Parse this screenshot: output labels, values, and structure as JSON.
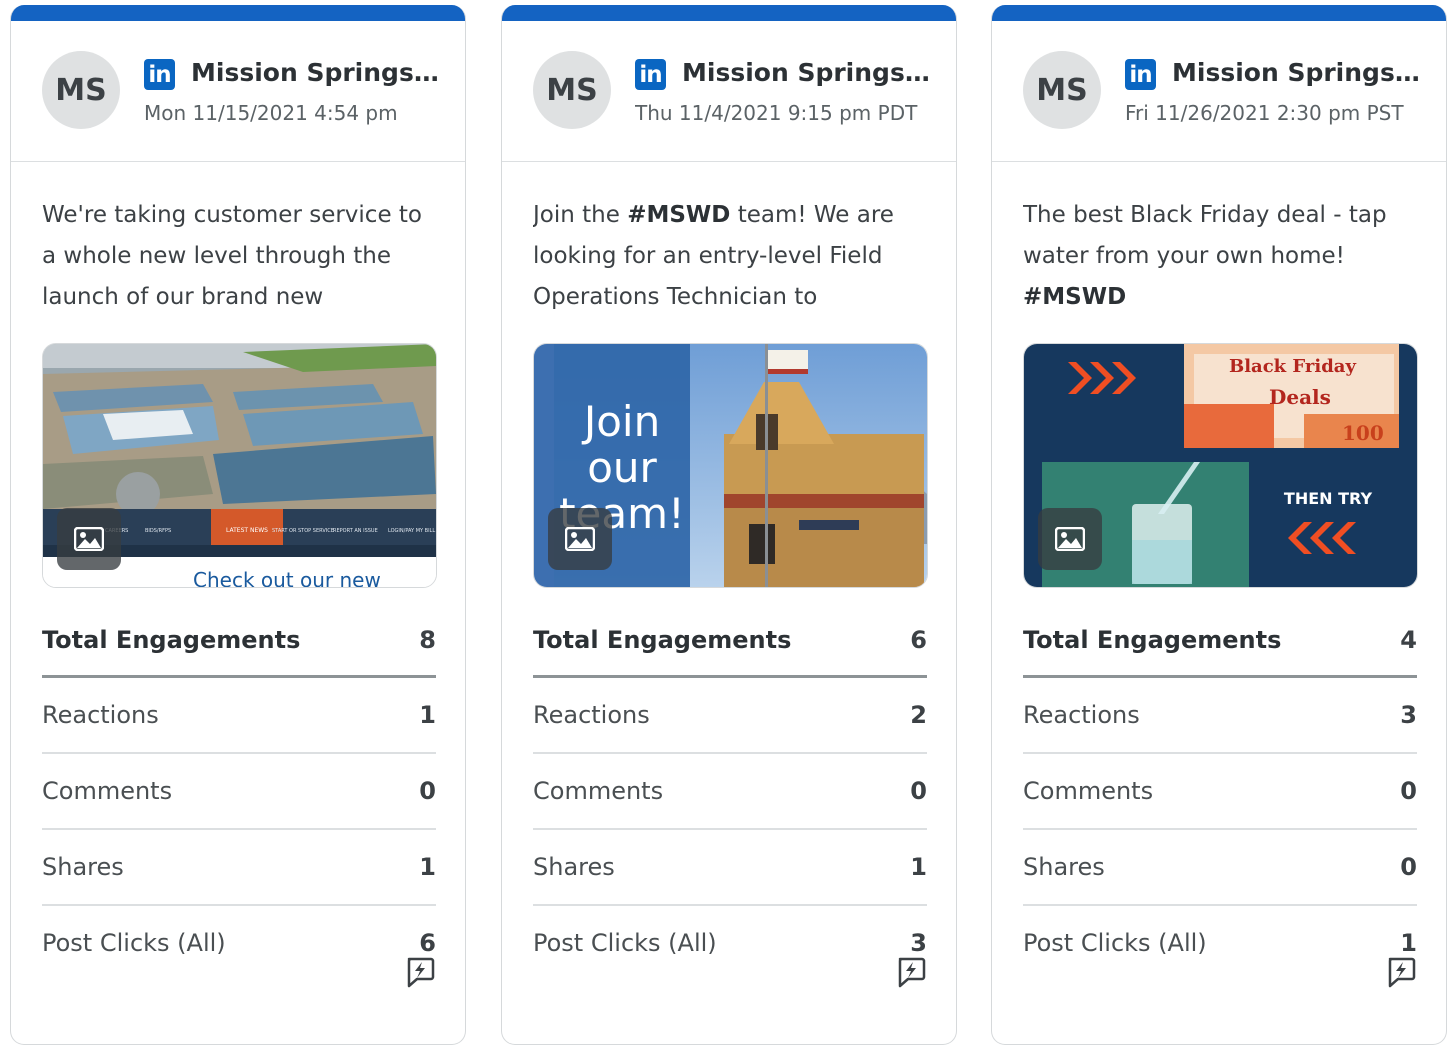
{
  "colors": {
    "accent": "#1463c2",
    "linkedin": "#0a66c2"
  },
  "cards": [
    {
      "avatar": "MS",
      "network_icon": "linkedin-icon",
      "account": "Mission Springs Water District",
      "date": "Mon 11/15/2021 4:54 pm",
      "text_parts": [
        "We're taking customer service to a whole new level through the launch of our brand new"
      ],
      "image_caption": "Check out our new",
      "image_nav": [
        "NEWS",
        "CAREERS",
        "BIDS/RFPS",
        "LATEST NEWS",
        "START OR STOP SERVICE",
        "REPORT AN ISSUE",
        "LOGIN/PAY MY BILL"
      ],
      "stats": {
        "total_label": "Total Engagements",
        "total": "8",
        "rows": [
          {
            "label": "Reactions",
            "value": "1"
          },
          {
            "label": "Comments",
            "value": "0"
          },
          {
            "label": "Shares",
            "value": "1"
          },
          {
            "label": "Post Clicks (All)",
            "value": "6"
          }
        ]
      }
    },
    {
      "avatar": "MS",
      "network_icon": "linkedin-icon",
      "account": "Mission Springs Water District",
      "date": "Thu 11/4/2021 9:15 pm PDT",
      "text_parts": [
        "Join the ",
        "#MSWD",
        " team! We are looking for an entry-level Field Operations Technician to"
      ],
      "image_text": [
        "Join",
        "our",
        "team!"
      ],
      "stats": {
        "total_label": "Total Engagements",
        "total": "6",
        "rows": [
          {
            "label": "Reactions",
            "value": "2"
          },
          {
            "label": "Comments",
            "value": "0"
          },
          {
            "label": "Shares",
            "value": "1"
          },
          {
            "label": "Post Clicks (All)",
            "value": "3"
          }
        ]
      }
    },
    {
      "avatar": "MS",
      "network_icon": "linkedin-icon",
      "account": "Mission Springs Water District",
      "date": "Fri 11/26/2021 2:30 pm PST",
      "text_parts": [
        "The best Black Friday deal - tap water from your own home! ",
        "#MSWD"
      ],
      "image_text": [
        "Black Friday",
        "Deals",
        "100",
        "THEN TRY"
      ],
      "stats": {
        "total_label": "Total Engagements",
        "total": "4",
        "rows": [
          {
            "label": "Reactions",
            "value": "3"
          },
          {
            "label": "Comments",
            "value": "0"
          },
          {
            "label": "Shares",
            "value": "0"
          },
          {
            "label": "Post Clicks (All)",
            "value": "1"
          }
        ]
      }
    }
  ]
}
